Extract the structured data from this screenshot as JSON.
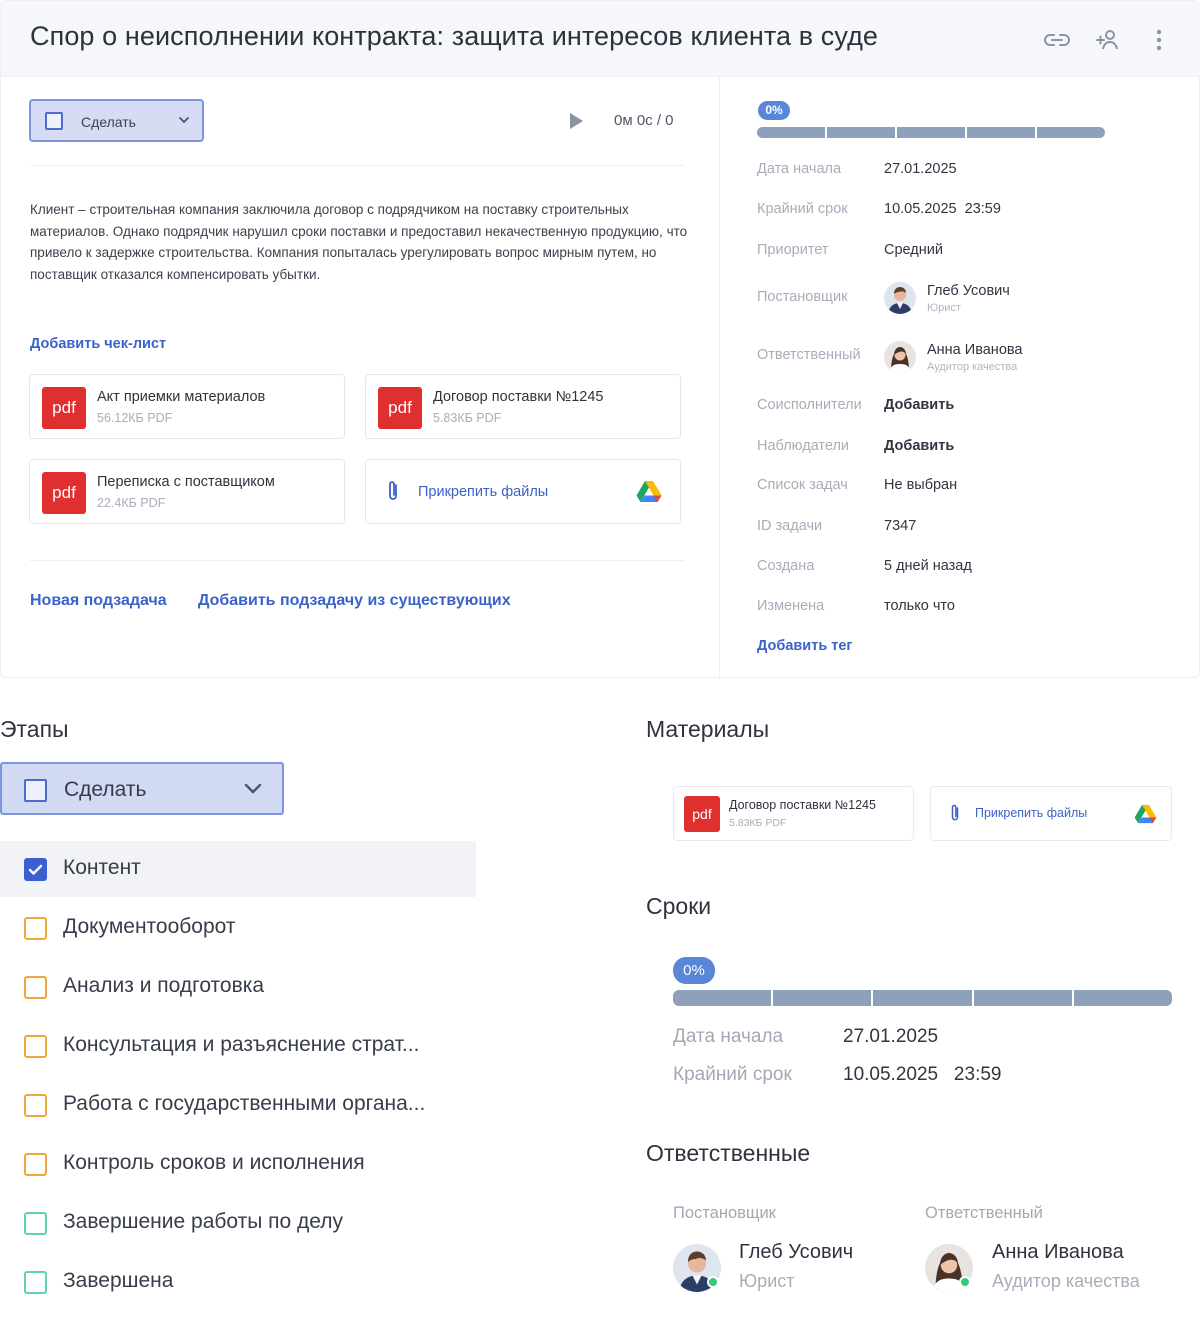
{
  "task": {
    "title": "Спор о неисполнении контракта: защита интересов клиента в суде",
    "status_label": "Сделать",
    "timer": "0м 0с / 0",
    "description": "Клиент – строительная компания заключила договор с подрядчиком на поставку строительных материалов. Однако подрядчик нарушил сроки поставки и предоставил некачественную продукцию, что привело к задержке строительства. Компания попыталась урегулировать вопрос мирным путем, но поставщик отказался компенсировать убытки.",
    "add_checklist": "Добавить чек-лист",
    "files": [
      {
        "icon": "pdf",
        "name": "Акт приемки материалов",
        "meta": "56.12КБ PDF"
      },
      {
        "icon": "pdf",
        "name": "Договор поставки №1245",
        "meta": "5.83КБ PDF"
      },
      {
        "icon": "pdf",
        "name": "Переписка с поставщиком",
        "meta": "22.4КБ PDF"
      }
    ],
    "attach_files": "Прикрепить файлы",
    "new_subtask": "Новая подзадача",
    "add_existing_subtask": "Добавить подзадачу из существующих"
  },
  "properties": {
    "progress": "0%",
    "progress_value": 0,
    "start_label": "Дата начала",
    "start_value": "27.01.2025",
    "deadline_label": "Крайний срок",
    "deadline_value": "10.05.2025  23:59",
    "priority_label": "Приоритет",
    "priority_value": "Средний",
    "creator_label": "Постановщик",
    "creator_name": "Глеб Усович",
    "creator_role": "Юрист",
    "assignee_label": "Ответственный",
    "assignee_name": "Анна Иванова",
    "assignee_role": "Аудитор качества",
    "coexecutors_label": "Соисполнители",
    "coexecutors_action": "Добавить",
    "observers_label": "Наблюдатели",
    "observers_action": "Добавить",
    "tasklist_label": "Список задач",
    "tasklist_value": "Не выбран",
    "id_label": "ID задачи",
    "id_value": "7347",
    "created_label": "Создана",
    "created_value": "5 дней назад",
    "modified_label": "Изменена",
    "modified_value": "только что",
    "add_tag": "Добавить тег"
  },
  "stages": {
    "heading": "Этапы",
    "dropdown_label": "Сделать",
    "items": [
      {
        "label": "Контент",
        "checked": true,
        "color": "#3b5fd0"
      },
      {
        "label": "Документооборот",
        "checked": false,
        "color": "#f0a73a"
      },
      {
        "label": "Анализ и подготовка",
        "checked": false,
        "color": "#f0a73a"
      },
      {
        "label": "Консультация и разъяснение страт...",
        "checked": false,
        "color": "#f0a73a"
      },
      {
        "label": "Работа с государственными органа...",
        "checked": false,
        "color": "#f0a73a"
      },
      {
        "label": "Контроль сроков и исполнения",
        "checked": false,
        "color": "#f0a73a"
      },
      {
        "label": "Завершение работы по делу",
        "checked": false,
        "color": "#5fd1b9"
      },
      {
        "label": "Завершена",
        "checked": false,
        "color": "#5fd1b9"
      }
    ]
  },
  "materials": {
    "heading": "Материалы",
    "file_icon": "pdf",
    "file_name": "Договор поставки №1245",
    "file_meta": "5.83КБ PDF",
    "attach_files": "Прикрепить файлы"
  },
  "deadlines": {
    "heading": "Сроки",
    "progress": "0%",
    "progress_value": 0,
    "start_label": "Дата начала",
    "start_value": "27.01.2025",
    "deadline_label": "Крайний срок",
    "deadline_value": "10.05.2025   23:59"
  },
  "responsibles": {
    "heading": "Ответственные",
    "creator_label": "Постановщик",
    "creator_name": "Глеб Усович",
    "creator_role": "Юрист",
    "assignee_label": "Ответственный",
    "assignee_name": "Анна Иванова",
    "assignee_role": "Аудитор качества"
  },
  "colors": {
    "accent": "#3a62c9",
    "pdf_red": "#df2f2f",
    "dropdown_bg": "#d5dcf4",
    "progress_badge": "#5a86d8",
    "progress_track": "#8ea0bc"
  },
  "icons": [
    "link-icon",
    "add-user-icon",
    "more-vertical-icon",
    "play-icon",
    "chevron-down-icon",
    "paperclip-icon",
    "google-drive-icon",
    "pdf-icon",
    "checkbox-icon"
  ]
}
